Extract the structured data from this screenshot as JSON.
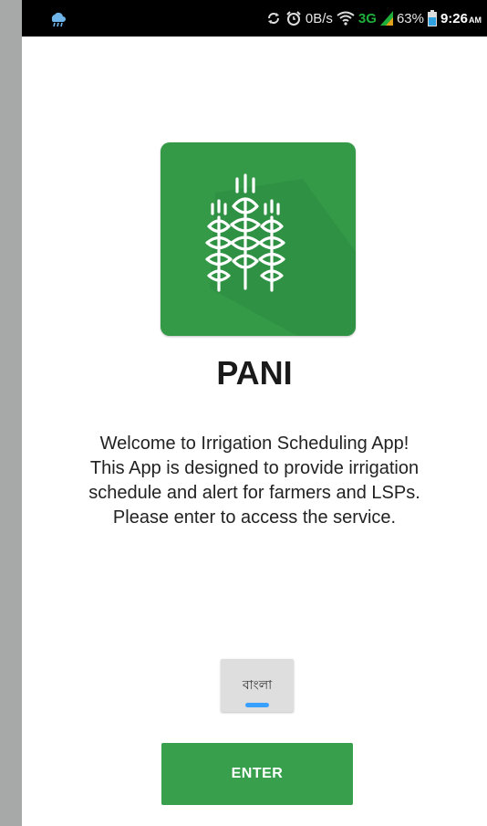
{
  "status_bar": {
    "speed": "0B/s",
    "network": "3G",
    "battery": "63%",
    "time": "9:26",
    "ampm": "AM",
    "icons": [
      "cloud-icon",
      "sync-icon",
      "alarm-icon",
      "wifi-icon",
      "signal-icon",
      "battery-icon"
    ]
  },
  "app": {
    "title": "PANI",
    "icon": "wheat-icon",
    "welcome_lines": [
      "Welcome to Irrigation Scheduling App!",
      "This App is designed to provide irrigation",
      "schedule and alert for farmers and LSPs.",
      "Please enter to access the service."
    ]
  },
  "buttons": {
    "language": "বাংলা",
    "enter": "ENTER"
  },
  "colors": {
    "brand_green": "#349a48",
    "button_green": "#38a04c",
    "network_green": "#1fae3a"
  }
}
